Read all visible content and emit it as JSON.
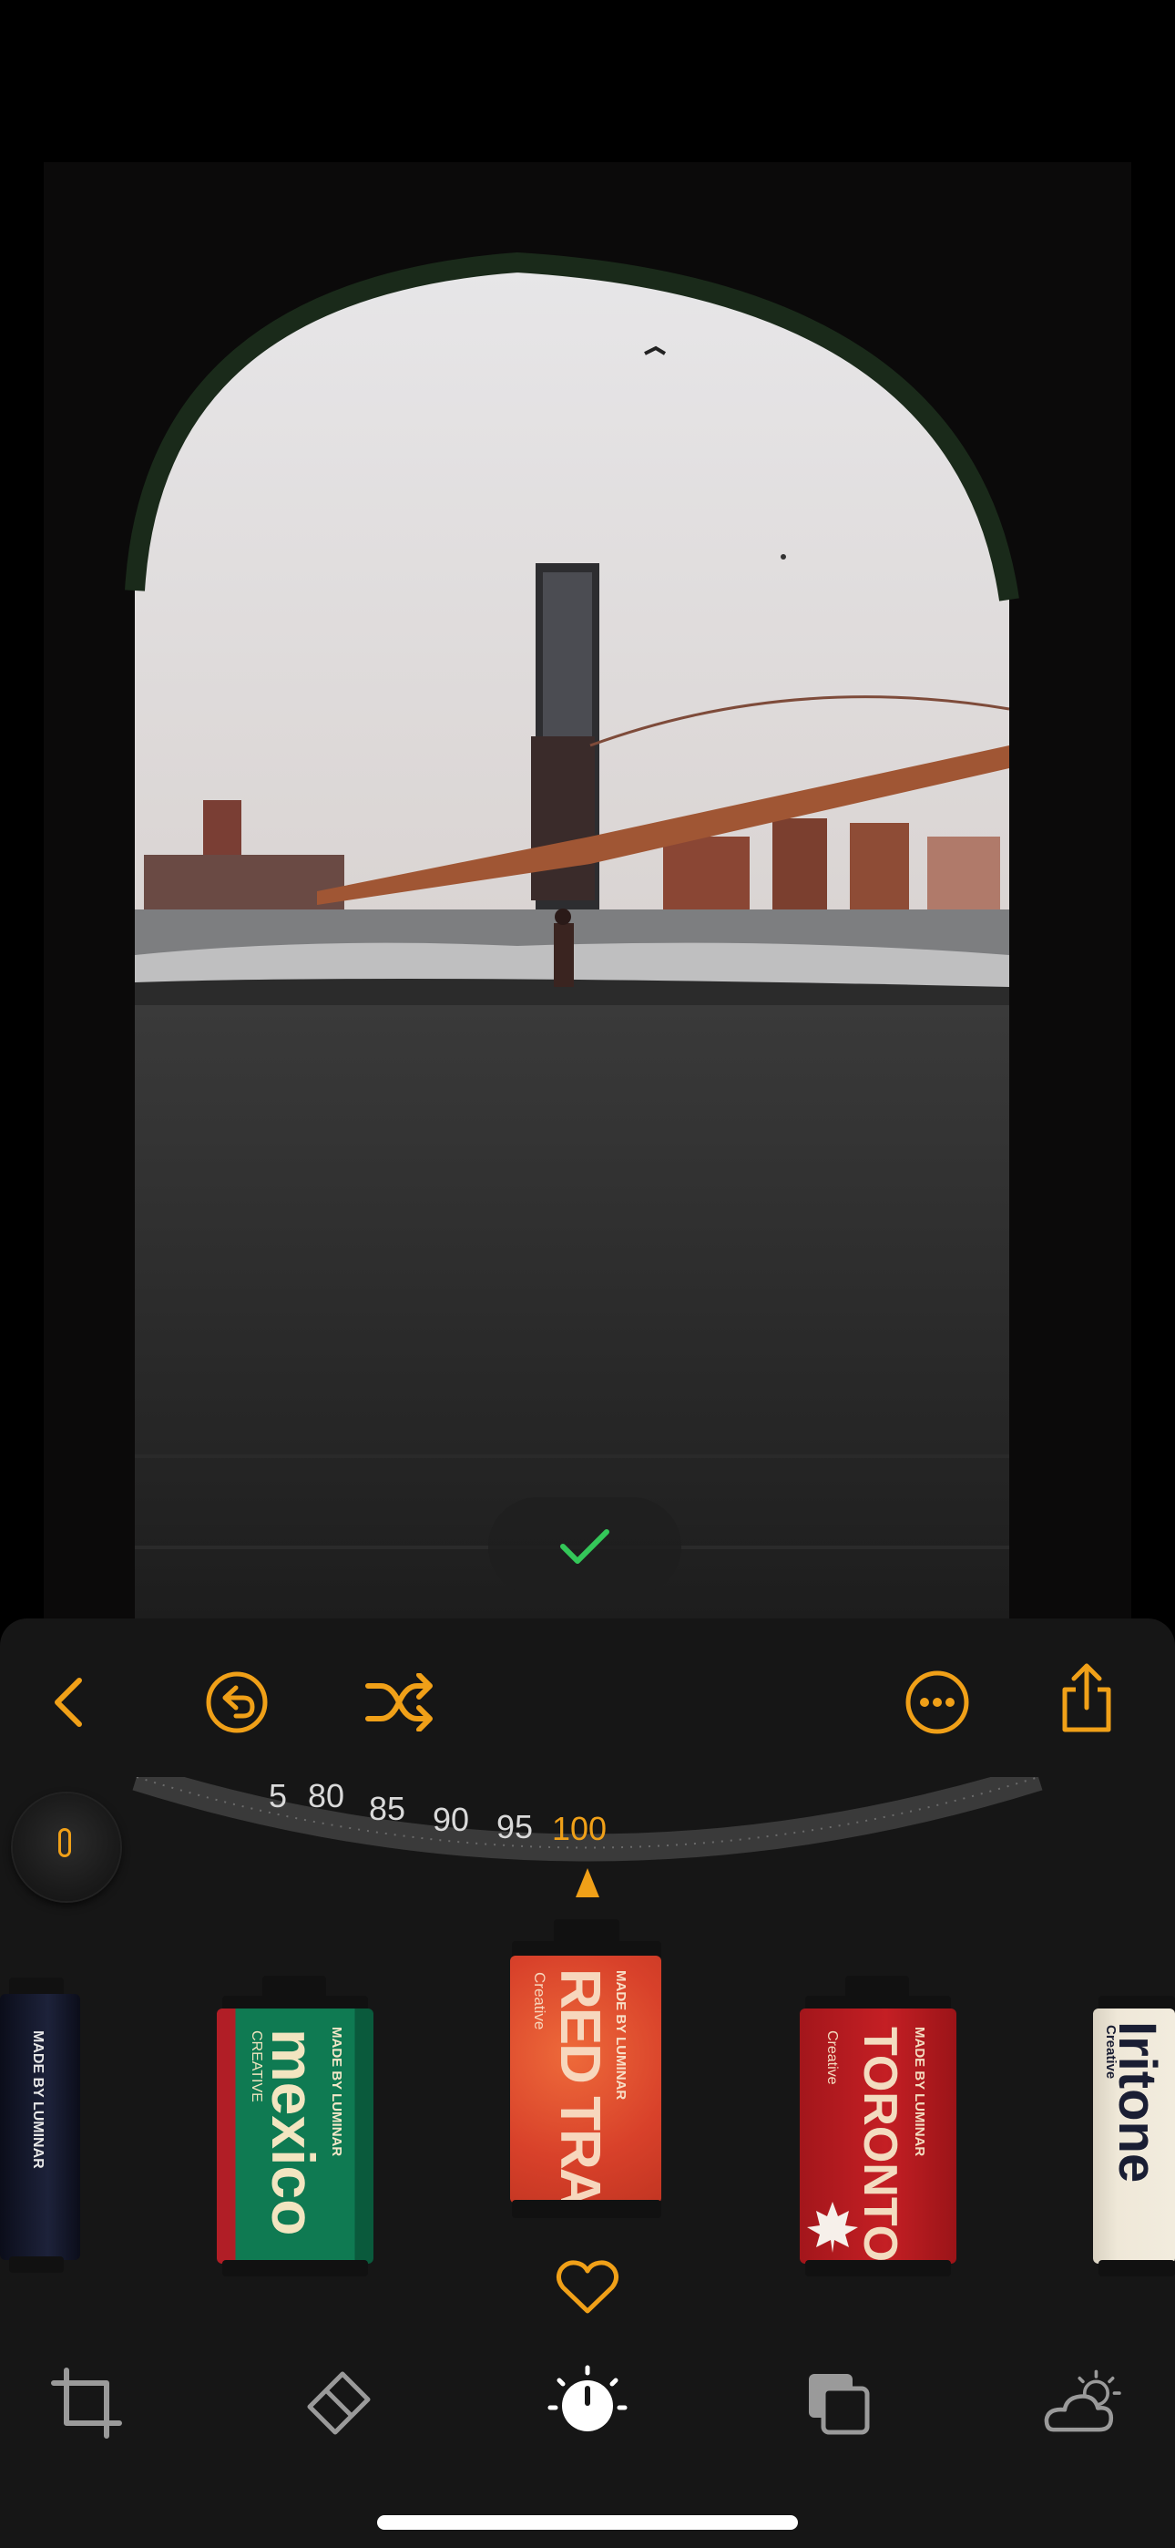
{
  "photo": {
    "description_icon": "photo-canvas"
  },
  "toolbar": {
    "back": "chevron-left-icon",
    "undo": "undo-icon",
    "shuffle": "shuffle-icon",
    "more": "ellipsis-circle-icon",
    "share": "share-icon"
  },
  "dial": {
    "values": [
      "5",
      "80",
      "85",
      "90",
      "95",
      "100"
    ],
    "active": "100",
    "knob_value": "0"
  },
  "films": [
    {
      "brand": "MADE BY LUMINAR",
      "name": "",
      "sub": "",
      "color": "#1a1e33"
    },
    {
      "brand": "MADE BY LUMINAR",
      "name": "mexico",
      "sub": "CREATIVE",
      "color": "#0f7a52"
    },
    {
      "brand": "MADE BY LUMINAR",
      "name": "RED TRACE",
      "sub": "Creative",
      "color": "#e04a2a"
    },
    {
      "brand": "MADE BY LUMINAR",
      "name": "TORONTO",
      "sub": "Creative",
      "color": "#c41f24"
    },
    {
      "brand": "",
      "name": "Iritone",
      "sub": "Creative",
      "color": "#efe8d8"
    }
  ],
  "favorite": "heart-icon",
  "tabs": [
    {
      "name": "crop-icon"
    },
    {
      "name": "eraser-icon"
    },
    {
      "name": "adjust-dial-icon"
    },
    {
      "name": "layers-icon"
    },
    {
      "name": "weather-icon"
    }
  ],
  "colors": {
    "accent": "#f0a018",
    "confirm": "#34c759",
    "panel": "#161616"
  }
}
